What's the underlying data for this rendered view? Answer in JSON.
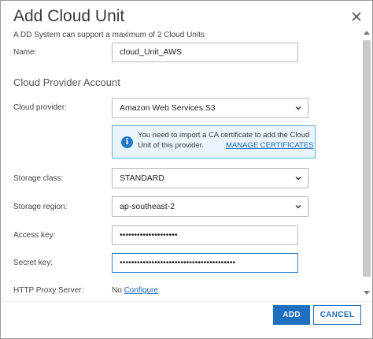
{
  "dialog": {
    "title": "Add Cloud Unit",
    "close_icon": "close-icon"
  },
  "form": {
    "subtitle": "A DD System can support a maximum of 2 Cloud Units",
    "name_label": "Name:",
    "name_value": "cloud_Unit_AWS",
    "section_title": "Cloud Provider Account",
    "provider_label": "Cloud provider:",
    "provider_value": "Amazon Web Services S3",
    "info_text_line1": "You need to import a CA certificate to add the Cloud",
    "info_text_line2": "Unit of this provider.",
    "info_link": "MANAGE CERTIFICATES",
    "info_icon": "info-icon",
    "storage_class_label": "Storage class:",
    "storage_class_value": "STANDARD",
    "storage_region_label": "Storage region:",
    "storage_region_value": "ap-southeast-2",
    "access_key_label": "Access key:",
    "access_key_value": "••••••••••••••••••••",
    "secret_key_label": "Secret key:",
    "secret_key_value": "••••••••••••••••••••••••••••••••••••••••",
    "proxy_label": "HTTP Proxy Server:",
    "proxy_value": "No",
    "proxy_link": "Configure"
  },
  "footer": {
    "add_label": "ADD",
    "cancel_label": "CANCEL"
  },
  "colors": {
    "accent": "#1f6fbf",
    "info_bg": "#e9f5fb",
    "info_border": "#5ab3d8",
    "focus_border": "#2a7fd0"
  }
}
